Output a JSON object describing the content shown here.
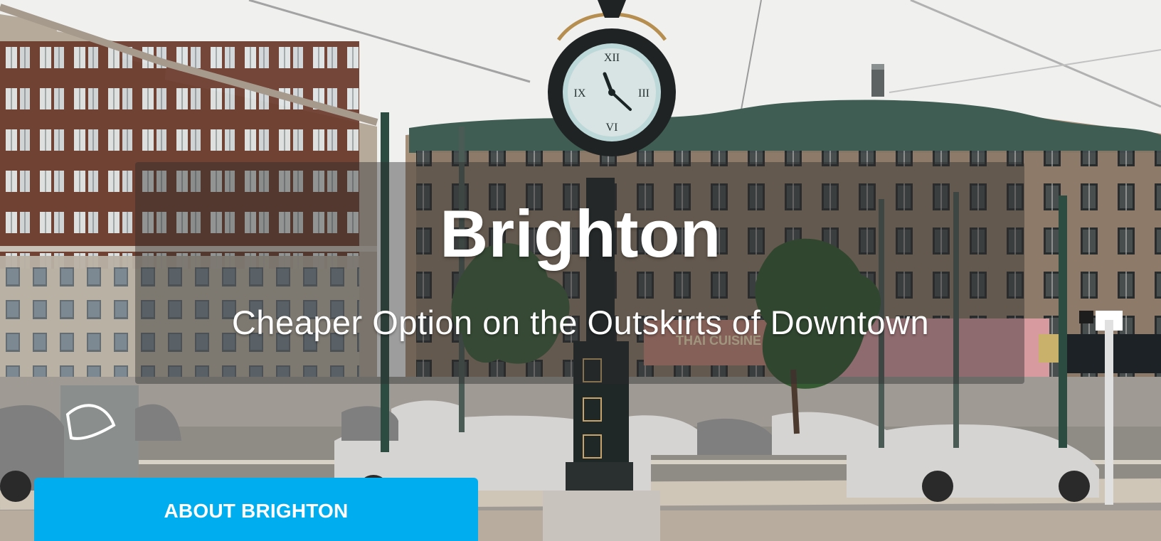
{
  "hero": {
    "title": "Brighton",
    "subtitle": "Cheaper Option on the Outskirts of Downtown",
    "background_description": ""
  },
  "actions": {
    "about_button_label": "ABOUT BRIGHTON"
  },
  "colors": {
    "button": "#00aeef",
    "overlay": "#2a2a2a",
    "text": "#ffffff"
  }
}
